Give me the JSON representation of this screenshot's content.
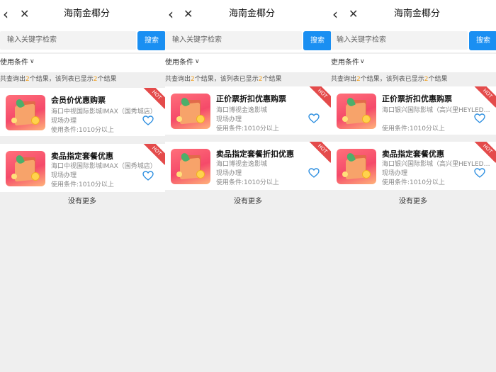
{
  "panels": [
    {
      "header": {
        "back_icon": "chevron-left-icon",
        "close_icon": "close-icon",
        "title": "海南金椰分"
      },
      "search": {
        "placeholder": "输入关键字检索",
        "button": "搜索"
      },
      "filter": {
        "label": "使用条件"
      },
      "result": {
        "prefix": "共查询出",
        "count": "2",
        "middle": "个结果，该列表已显示",
        "shown": "2",
        "suffix": "个结果"
      },
      "cards": [
        {
          "title": "会员价优惠购票",
          "venue": "海口中视国际影城IMAX（国秀城店）",
          "method": "现场办理",
          "condition": "使用条件:1010分以上",
          "badge": "HOT"
        },
        {
          "title": "卖品指定套餐优惠",
          "venue": "海口中视国际影城IMAX（国秀城店）",
          "method": "现场办理",
          "condition": "使用条件:1010分以上",
          "badge": "HOT"
        }
      ],
      "no_more": "没有更多"
    },
    {
      "header": {
        "back_icon": "chevron-left-icon",
        "close_icon": "close-icon",
        "title": "海南金椰分"
      },
      "search": {
        "placeholder": "输入关键字检索",
        "button": "搜索"
      },
      "filter": {
        "label": "使用条件"
      },
      "result": {
        "prefix": "共查询出",
        "count": "2",
        "middle": "个结果，该列表已显示",
        "shown": "2",
        "suffix": "个结果"
      },
      "cards": [
        {
          "title": "正价票折扣优惠购票",
          "venue": "海口博视金逸影城",
          "method": "现场办理",
          "condition": "使用条件:1010分以上",
          "badge": "HOT"
        },
        {
          "title": "卖品指定套餐折扣优惠",
          "venue": "海口博视金逸影城",
          "method": "现场办理",
          "condition": "使用条件:1010分以上",
          "badge": "HOT"
        }
      ],
      "no_more": "没有更多"
    },
    {
      "header": {
        "back_icon": "chevron-left-icon",
        "close_icon": "close-icon",
        "title": "海南金椰分"
      },
      "search": {
        "placeholder": "输入关键字检索",
        "button": "搜索"
      },
      "filter": {
        "label": "吏用条件"
      },
      "result": {
        "prefix": "共查询出",
        "count": "2",
        "middle": "个结果，该列表已显示",
        "shown": "2",
        "suffix": "个结果"
      },
      "cards": [
        {
          "title": "正价票折扣优惠购票",
          "venue": "海口银兴国际影城（高兴里HEYLED…",
          "method": "",
          "condition": "使用条件:1010分以上",
          "badge": "HOT"
        },
        {
          "title": "卖品指定套餐优惠",
          "venue": "海口银兴国际影城（高兴里HEYLED…",
          "method": "现场办理",
          "condition": "使用条件:1010分以上",
          "badge": "HOT"
        }
      ],
      "no_more": "没有更多"
    }
  ],
  "colors": {
    "accent": "#1a8ff2",
    "highlight": "#f0a020",
    "hot": "#e44b4b",
    "heart": "#2e8fe0"
  }
}
